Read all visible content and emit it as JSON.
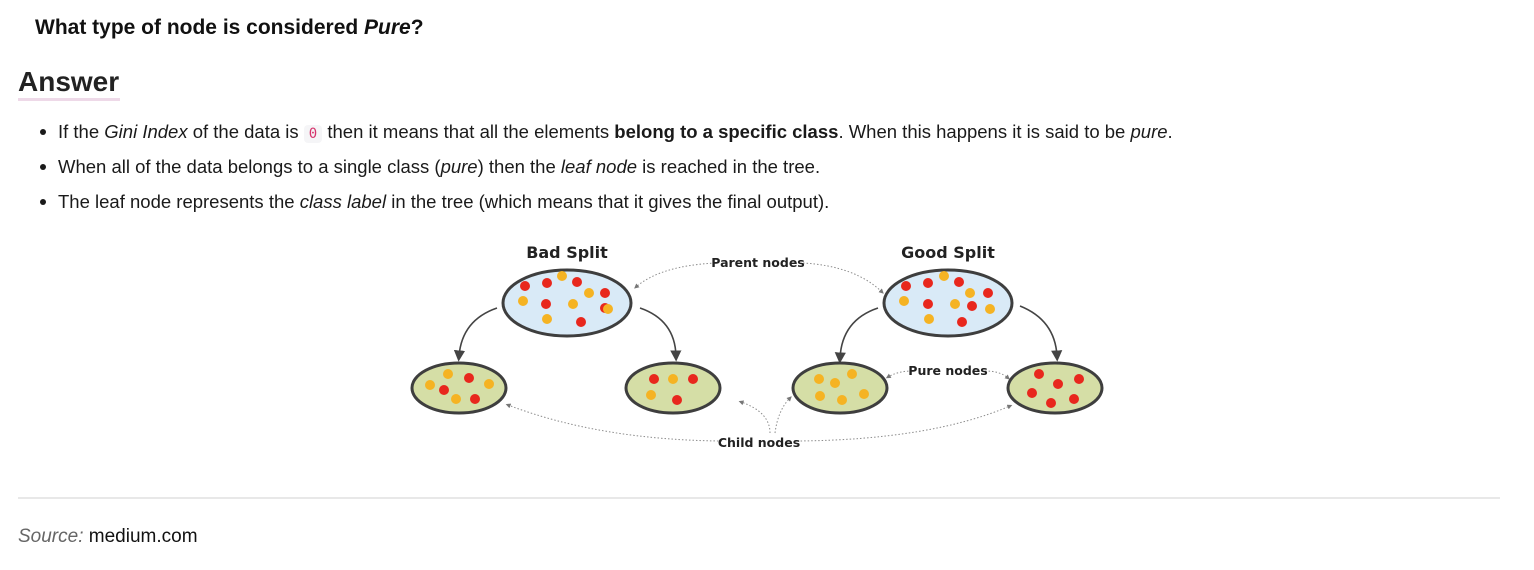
{
  "question": {
    "text_before": "What type of node is considered ",
    "em": "Pure",
    "text_after": "?"
  },
  "answer_heading": "Answer",
  "bullets": [
    {
      "t1": "If the ",
      "em1": "Gini Index",
      "t2": " of the data is ",
      "code": "0",
      "t3": " then it means that all the elements ",
      "bold": "belong to a specific class",
      "t4": ". When this happens it is said to be ",
      "em2": "pure",
      "t5": "."
    },
    {
      "t1": "When all of the data belongs to a single class (",
      "em1": "pure",
      "t2": ") then the ",
      "em2": "leaf node",
      "t3": " is reached in the tree."
    },
    {
      "t1": "The leaf node represents the ",
      "em1": "class label",
      "t2": " in the tree (which means that it gives the final output)."
    }
  ],
  "diagram": {
    "labels": {
      "bad_split": "Bad Split",
      "good_split": "Good Split",
      "parent_nodes": "Parent nodes",
      "pure_nodes": "Pure nodes",
      "child_nodes": "Child nodes"
    },
    "colors": {
      "red": "#e8271d",
      "orange": "#f5b323",
      "parent_fill": "#d9eaf7",
      "child_fill": "#d5dea6",
      "outline": "#3e3e3e"
    }
  },
  "source": {
    "label": "Source:",
    "value": "medium.com"
  }
}
